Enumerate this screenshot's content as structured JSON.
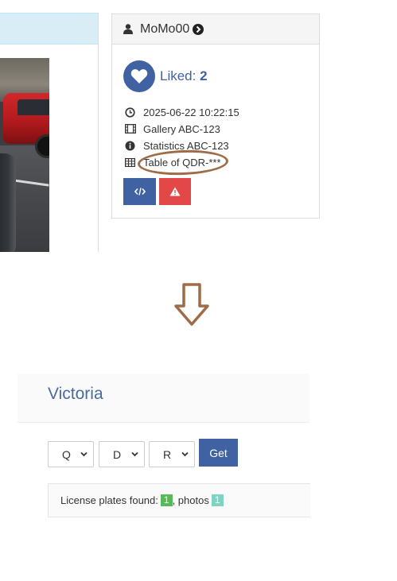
{
  "photo_panel": {
    "photo_icon": "car-photo"
  },
  "user_card": {
    "username": "MoMo00",
    "user_icon": "user-icon",
    "profile_icon": "arrow-circle-right-icon",
    "liked_label": "Liked:",
    "liked_count": "2",
    "meta": [
      {
        "icon": "clock-icon",
        "text": "2025-06-22 10:22:15"
      },
      {
        "icon": "film-icon",
        "text": "Gallery ABC-123"
      },
      {
        "icon": "info-circle-icon",
        "text": "Statistics ABC-123"
      },
      {
        "icon": "table-icon",
        "text": "Table of QDR-***"
      }
    ],
    "code_button_icon": "code-icon",
    "report_button_icon": "warning-icon",
    "colors": {
      "primary": "#4062a2",
      "danger": "#e34848",
      "annotation": "#a06c48"
    }
  },
  "arrow": {
    "icon": "down-arrow-icon"
  },
  "region": {
    "title": "Victoria",
    "selects": [
      "Q",
      "D",
      "R"
    ],
    "get_label": "Get",
    "found_label": "License plates found:",
    "plates_count": "1",
    "photos_label": ", photos",
    "photos_count": "1",
    "colors": {
      "green_badge": "#5cb85c",
      "teal_badge": "#7fd4c1"
    }
  }
}
